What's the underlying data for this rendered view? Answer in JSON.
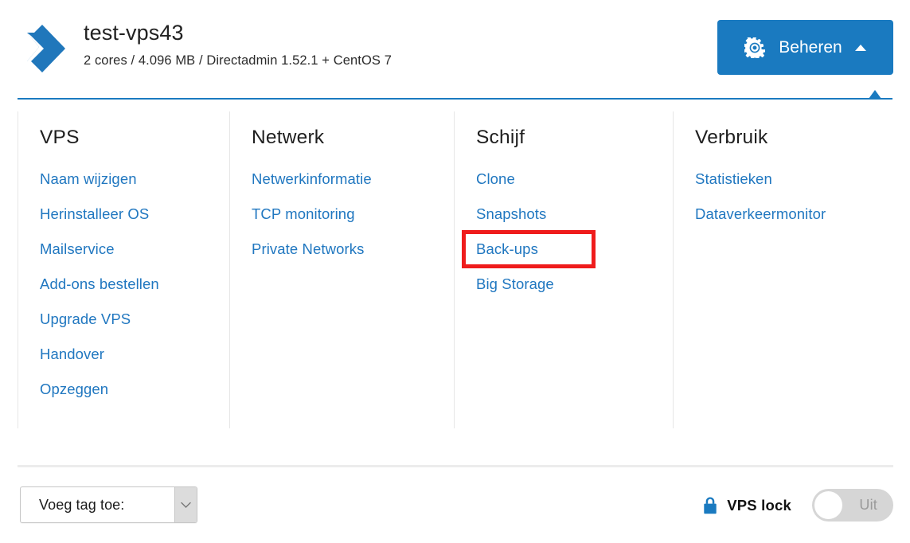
{
  "header": {
    "logo_icon": "transip-chevron-logo",
    "title": "test-vps43",
    "subtitle": "2 cores / 4.096 MB / Directadmin 1.52.1 + CentOS 7",
    "manage_button": {
      "label": "Beheren",
      "gear_icon": "gear-icon",
      "caret_icon": "caret-up-icon"
    },
    "accent_color": "#1a7ac0"
  },
  "menu": {
    "columns": [
      {
        "heading": "VPS",
        "items": [
          {
            "label": "Naam wijzigen",
            "highlighted": false
          },
          {
            "label": "Herinstalleer OS",
            "highlighted": false
          },
          {
            "label": "Mailservice",
            "highlighted": false
          },
          {
            "label": "Add-ons bestellen",
            "highlighted": false
          },
          {
            "label": "Upgrade VPS",
            "highlighted": false
          },
          {
            "label": "Handover",
            "highlighted": false
          },
          {
            "label": "Opzeggen",
            "highlighted": false
          }
        ]
      },
      {
        "heading": "Netwerk",
        "items": [
          {
            "label": "Netwerkinformatie",
            "highlighted": false
          },
          {
            "label": "TCP monitoring",
            "highlighted": false
          },
          {
            "label": "Private Networks",
            "highlighted": false
          }
        ]
      },
      {
        "heading": "Schijf",
        "items": [
          {
            "label": "Clone",
            "highlighted": false
          },
          {
            "label": "Snapshots",
            "highlighted": false
          },
          {
            "label": "Back-ups",
            "highlighted": true
          },
          {
            "label": "Big Storage",
            "highlighted": false
          }
        ]
      },
      {
        "heading": "Verbruik",
        "items": [
          {
            "label": "Statistieken",
            "highlighted": false
          },
          {
            "label": "Dataverkeermonitor",
            "highlighted": false
          }
        ]
      }
    ],
    "link_color": "#2077c0",
    "highlight_color": "#ef1c1c"
  },
  "footer": {
    "tag_select": {
      "value": "Voeg tag toe:",
      "chevron_icon": "chevron-down-icon"
    },
    "vps_lock": {
      "icon": "lock-icon",
      "label": "VPS lock",
      "state": "Uit",
      "enabled": false,
      "icon_color": "#1a7ac0"
    }
  }
}
